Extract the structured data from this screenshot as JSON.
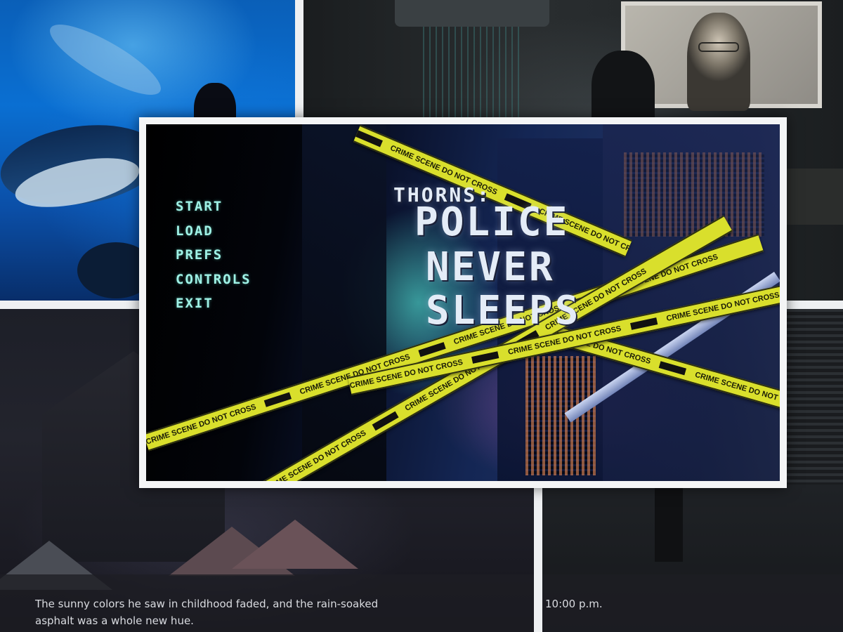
{
  "menu": {
    "items": [
      {
        "label": "START"
      },
      {
        "label": "LOAD"
      },
      {
        "label": "PREFS"
      },
      {
        "label": "CONTROLS"
      },
      {
        "label": "EXIT"
      }
    ]
  },
  "title": {
    "prefix": "THORNS:",
    "line1": "POLICE",
    "line2": "NEVER",
    "line3": "SLEEPS"
  },
  "tape": {
    "text": "CRIME SCENE DO NOT CROSS"
  },
  "scenes": {
    "market_dialogue": "The sunny colors he saw in childhood faded, and the rain-soaked asphalt was a whole new hue.",
    "room_dialogue": "10:00 p.m."
  },
  "colors": {
    "menu_text": "#9ff2e6",
    "tape_yellow": "#d9df2c",
    "frame": "#f4f5f6"
  }
}
